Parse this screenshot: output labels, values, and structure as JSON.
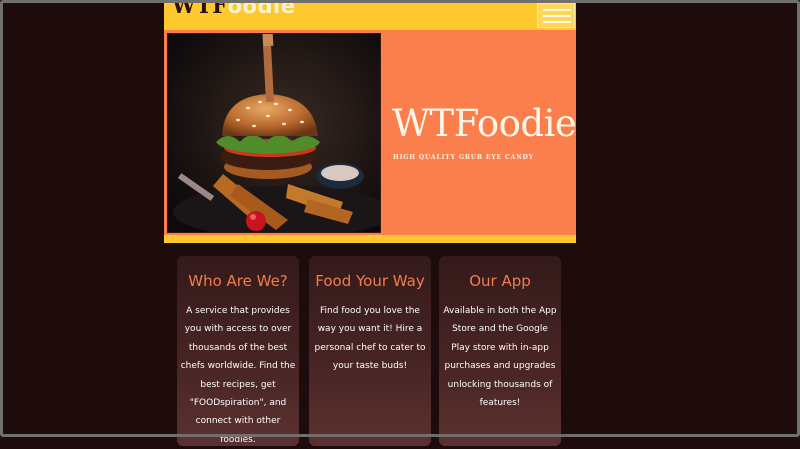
{
  "header": {
    "logo_part1": "WTF",
    "logo_part2": "oodie",
    "menu_icon": "hamburger-menu-icon"
  },
  "hero": {
    "image_alt": "burger",
    "title": "WTFoodie",
    "tagline": "HIGH QUALITY GRUB EYE CANDY"
  },
  "cards": [
    {
      "title": "Who Are We?",
      "body": "A service that provides you with access to over thousands of the best chefs worldwide. Find the best recipes, get \"FOODspiration\", and connect with other foodies."
    },
    {
      "title": "Food Your Way",
      "body": "Find food you love the way you want it! Hire a personal chef to cater to your taste buds!"
    },
    {
      "title": "Our App",
      "body": "Available in both the App Store and the Google Play store with in-app purchases and upgrades unlocking thousands of features!"
    }
  ],
  "colors": {
    "page_bg": "#1e0c0d",
    "yellow": "#fdc92e",
    "orange": "#fa7f4d",
    "card_title": "#f47b4c"
  }
}
